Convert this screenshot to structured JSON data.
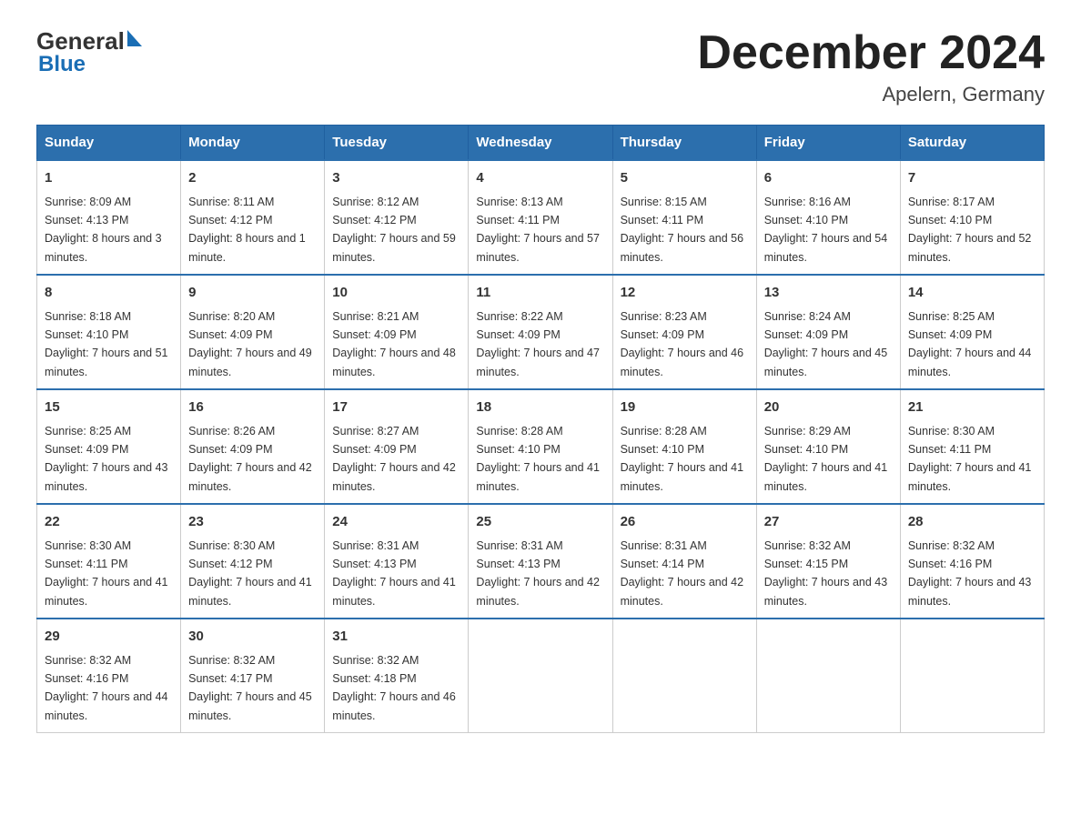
{
  "header": {
    "logo_general": "General",
    "logo_blue": "Blue",
    "month_title": "December 2024",
    "location": "Apelern, Germany"
  },
  "calendar": {
    "days_of_week": [
      "Sunday",
      "Monday",
      "Tuesday",
      "Wednesday",
      "Thursday",
      "Friday",
      "Saturday"
    ],
    "weeks": [
      [
        {
          "day": "1",
          "sunrise": "8:09 AM",
          "sunset": "4:13 PM",
          "daylight": "8 hours and 3 minutes."
        },
        {
          "day": "2",
          "sunrise": "8:11 AM",
          "sunset": "4:12 PM",
          "daylight": "8 hours and 1 minute."
        },
        {
          "day": "3",
          "sunrise": "8:12 AM",
          "sunset": "4:12 PM",
          "daylight": "7 hours and 59 minutes."
        },
        {
          "day": "4",
          "sunrise": "8:13 AM",
          "sunset": "4:11 PM",
          "daylight": "7 hours and 57 minutes."
        },
        {
          "day": "5",
          "sunrise": "8:15 AM",
          "sunset": "4:11 PM",
          "daylight": "7 hours and 56 minutes."
        },
        {
          "day": "6",
          "sunrise": "8:16 AM",
          "sunset": "4:10 PM",
          "daylight": "7 hours and 54 minutes."
        },
        {
          "day": "7",
          "sunrise": "8:17 AM",
          "sunset": "4:10 PM",
          "daylight": "7 hours and 52 minutes."
        }
      ],
      [
        {
          "day": "8",
          "sunrise": "8:18 AM",
          "sunset": "4:10 PM",
          "daylight": "7 hours and 51 minutes."
        },
        {
          "day": "9",
          "sunrise": "8:20 AM",
          "sunset": "4:09 PM",
          "daylight": "7 hours and 49 minutes."
        },
        {
          "day": "10",
          "sunrise": "8:21 AM",
          "sunset": "4:09 PM",
          "daylight": "7 hours and 48 minutes."
        },
        {
          "day": "11",
          "sunrise": "8:22 AM",
          "sunset": "4:09 PM",
          "daylight": "7 hours and 47 minutes."
        },
        {
          "day": "12",
          "sunrise": "8:23 AM",
          "sunset": "4:09 PM",
          "daylight": "7 hours and 46 minutes."
        },
        {
          "day": "13",
          "sunrise": "8:24 AM",
          "sunset": "4:09 PM",
          "daylight": "7 hours and 45 minutes."
        },
        {
          "day": "14",
          "sunrise": "8:25 AM",
          "sunset": "4:09 PM",
          "daylight": "7 hours and 44 minutes."
        }
      ],
      [
        {
          "day": "15",
          "sunrise": "8:25 AM",
          "sunset": "4:09 PM",
          "daylight": "7 hours and 43 minutes."
        },
        {
          "day": "16",
          "sunrise": "8:26 AM",
          "sunset": "4:09 PM",
          "daylight": "7 hours and 42 minutes."
        },
        {
          "day": "17",
          "sunrise": "8:27 AM",
          "sunset": "4:09 PM",
          "daylight": "7 hours and 42 minutes."
        },
        {
          "day": "18",
          "sunrise": "8:28 AM",
          "sunset": "4:10 PM",
          "daylight": "7 hours and 41 minutes."
        },
        {
          "day": "19",
          "sunrise": "8:28 AM",
          "sunset": "4:10 PM",
          "daylight": "7 hours and 41 minutes."
        },
        {
          "day": "20",
          "sunrise": "8:29 AM",
          "sunset": "4:10 PM",
          "daylight": "7 hours and 41 minutes."
        },
        {
          "day": "21",
          "sunrise": "8:30 AM",
          "sunset": "4:11 PM",
          "daylight": "7 hours and 41 minutes."
        }
      ],
      [
        {
          "day": "22",
          "sunrise": "8:30 AM",
          "sunset": "4:11 PM",
          "daylight": "7 hours and 41 minutes."
        },
        {
          "day": "23",
          "sunrise": "8:30 AM",
          "sunset": "4:12 PM",
          "daylight": "7 hours and 41 minutes."
        },
        {
          "day": "24",
          "sunrise": "8:31 AM",
          "sunset": "4:13 PM",
          "daylight": "7 hours and 41 minutes."
        },
        {
          "day": "25",
          "sunrise": "8:31 AM",
          "sunset": "4:13 PM",
          "daylight": "7 hours and 42 minutes."
        },
        {
          "day": "26",
          "sunrise": "8:31 AM",
          "sunset": "4:14 PM",
          "daylight": "7 hours and 42 minutes."
        },
        {
          "day": "27",
          "sunrise": "8:32 AM",
          "sunset": "4:15 PM",
          "daylight": "7 hours and 43 minutes."
        },
        {
          "day": "28",
          "sunrise": "8:32 AM",
          "sunset": "4:16 PM",
          "daylight": "7 hours and 43 minutes."
        }
      ],
      [
        {
          "day": "29",
          "sunrise": "8:32 AM",
          "sunset": "4:16 PM",
          "daylight": "7 hours and 44 minutes."
        },
        {
          "day": "30",
          "sunrise": "8:32 AM",
          "sunset": "4:17 PM",
          "daylight": "7 hours and 45 minutes."
        },
        {
          "day": "31",
          "sunrise": "8:32 AM",
          "sunset": "4:18 PM",
          "daylight": "7 hours and 46 minutes."
        },
        null,
        null,
        null,
        null
      ]
    ]
  }
}
